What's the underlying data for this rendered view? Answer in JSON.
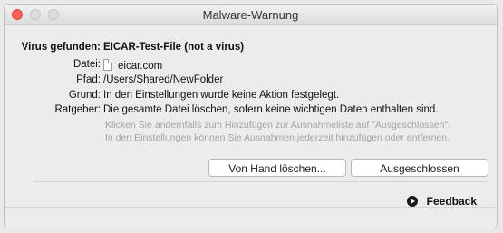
{
  "window": {
    "title": "Malware-Warnung"
  },
  "details": {
    "virus_label": "Virus gefunden:",
    "virus_value": "EICAR-Test-File (not a virus)",
    "file_label": "Datei:",
    "file_value": "eicar.com",
    "path_label": "Pfad:",
    "path_value": "/Users/Shared/NewFolder",
    "reason_label": "Grund:",
    "reason_value": "In den Einstellungen wurde keine Aktion festgelegt.",
    "advice_label": "Ratgeber:",
    "advice_value": "Die gesamte Datei löschen, sofern keine wichtigen Daten enthalten sind.",
    "hint_line1": "Klicken Sie andernfalls zum Hinzufügen zur Ausnahmeliste auf \"Ausgeschlossen\".",
    "hint_line2": "In den Einstellungen können Sie Ausnahmen jederzeit hinzufügen oder entfernen."
  },
  "actions": {
    "delete_label": "Von Hand löschen...",
    "exclude_label": "Ausgeschlossen"
  },
  "footer": {
    "feedback_label": "Feedback"
  }
}
